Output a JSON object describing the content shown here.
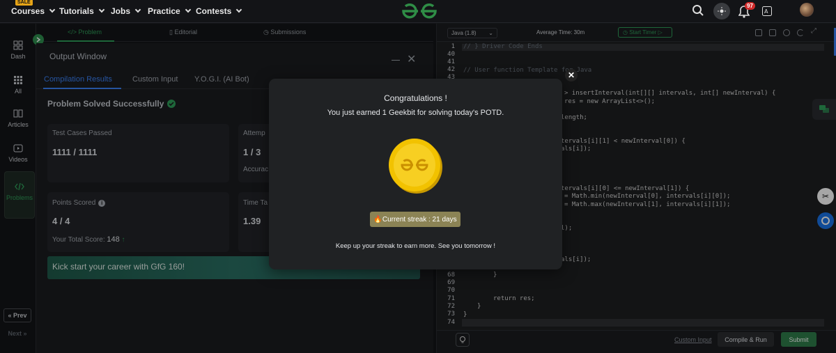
{
  "topnav": {
    "sale_badge": "SALE",
    "items": [
      {
        "label": "Courses"
      },
      {
        "label": "Tutorials"
      },
      {
        "label": "Jobs"
      },
      {
        "label": "Practice"
      },
      {
        "label": "Contests"
      }
    ],
    "notification_count": "97"
  },
  "left_rail": {
    "items": [
      {
        "label": "Dash"
      },
      {
        "label": "All"
      },
      {
        "label": "Articles"
      },
      {
        "label": "Videos"
      },
      {
        "label": "Problems"
      }
    ],
    "prev_label": "Prev",
    "next_label": "Next"
  },
  "problem_tabs": [
    {
      "label": "Problem"
    },
    {
      "label": "Editorial"
    },
    {
      "label": "Submissions"
    }
  ],
  "output_window": {
    "title": "Output Window",
    "tabs": [
      {
        "label": "Compilation Results"
      },
      {
        "label": "Custom Input"
      },
      {
        "label": "Y.O.G.I. (AI Bot)"
      }
    ],
    "status": "Problem Solved Successfully",
    "cards": {
      "test_cases_label": "Test Cases Passed",
      "test_cases_value": "1111 / 1111",
      "attempts_label": "Attemp",
      "attempts_value": "1 / 3",
      "accuracy_label": "Accurac",
      "points_label": "Points Scored",
      "points_value": "4 / 4",
      "total_score_label": "Your Total Score:",
      "total_score_value": "148",
      "time_label": "Time Ta",
      "time_value": "1.39"
    },
    "banner": "Kick start your career with GfG 160!"
  },
  "editor": {
    "language": "Java (1.8)",
    "average_time": "Average Time: 30m",
    "start_timer": "Start Timer",
    "line_numbers": [
      "1",
      "40",
      "41",
      "42",
      "43",
      "68",
      "69",
      "70",
      "71",
      "72",
      "73",
      "74"
    ],
    "code_lines": {
      "driver_comment": "// } Driver Code Ends",
      "template_comment": "// User function Template for Java",
      "l1": "> insertInterval(int[][] intervals, int[] newInterval) {",
      "l2": "res = new ArrayList<>();",
      "l3": "length;",
      "l4": "tervals[i][1] < newInterval[0]) {",
      "l5": "als[i]);",
      "l6": "tervals[i][0] <= newInterval[1]) {",
      "l7": "= Math.min(newInterval[0], intervals[i][0]);",
      "l8": "= Math.max(newInterval[1], intervals[i][1]);",
      "l9": "l);",
      "l10": "als[i]);",
      "l11": "}",
      "l12": "return res;",
      "l13": "}",
      "l14": "}"
    },
    "custom_input": "Custom Input",
    "compile_run": "Compile & Run",
    "submit": "Submit"
  },
  "modal": {
    "title": "Congratulations !",
    "subtitle": "You just earned 1 Geekbit for solving today's POTD.",
    "streak": "Current streak : 21 days",
    "footer": "Keep up your streak to earn more. See you tomorrow !"
  },
  "colors": {
    "accent_green": "#2f9e5a",
    "accent_blue": "#3b82f6",
    "coin_gold": "#f2c200",
    "streak_bg": "#8b8355"
  }
}
